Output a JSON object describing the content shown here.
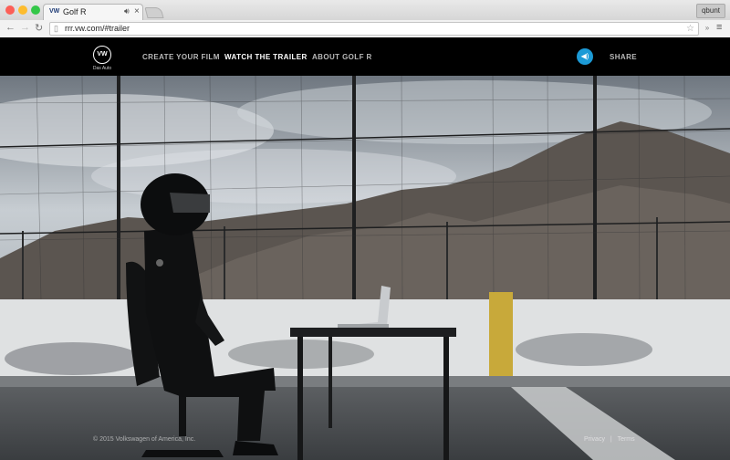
{
  "browser": {
    "tab_title": "Golf R",
    "tab_favicon": "VW",
    "url": "rrr.vw.com/#trailer",
    "user_label": "qbunt",
    "traffic_colors": [
      "#fc5f57",
      "#fdbc2e",
      "#33c748"
    ]
  },
  "site": {
    "logo_text": "VW",
    "logo_tagline": "Das Auto",
    "nav": [
      {
        "label": "CREATE YOUR FILM",
        "active": false
      },
      {
        "label": "WATCH THE TRAILER",
        "active": true
      },
      {
        "label": "ABOUT GOLF R",
        "active": false
      }
    ],
    "share_label": "SHARE",
    "accent": "#1c9ad6"
  },
  "footer": {
    "copyright": "© 2015 Volkswagen of America, Inc.",
    "privacy": "Privacy",
    "separator": "|",
    "terms": "Terms"
  }
}
